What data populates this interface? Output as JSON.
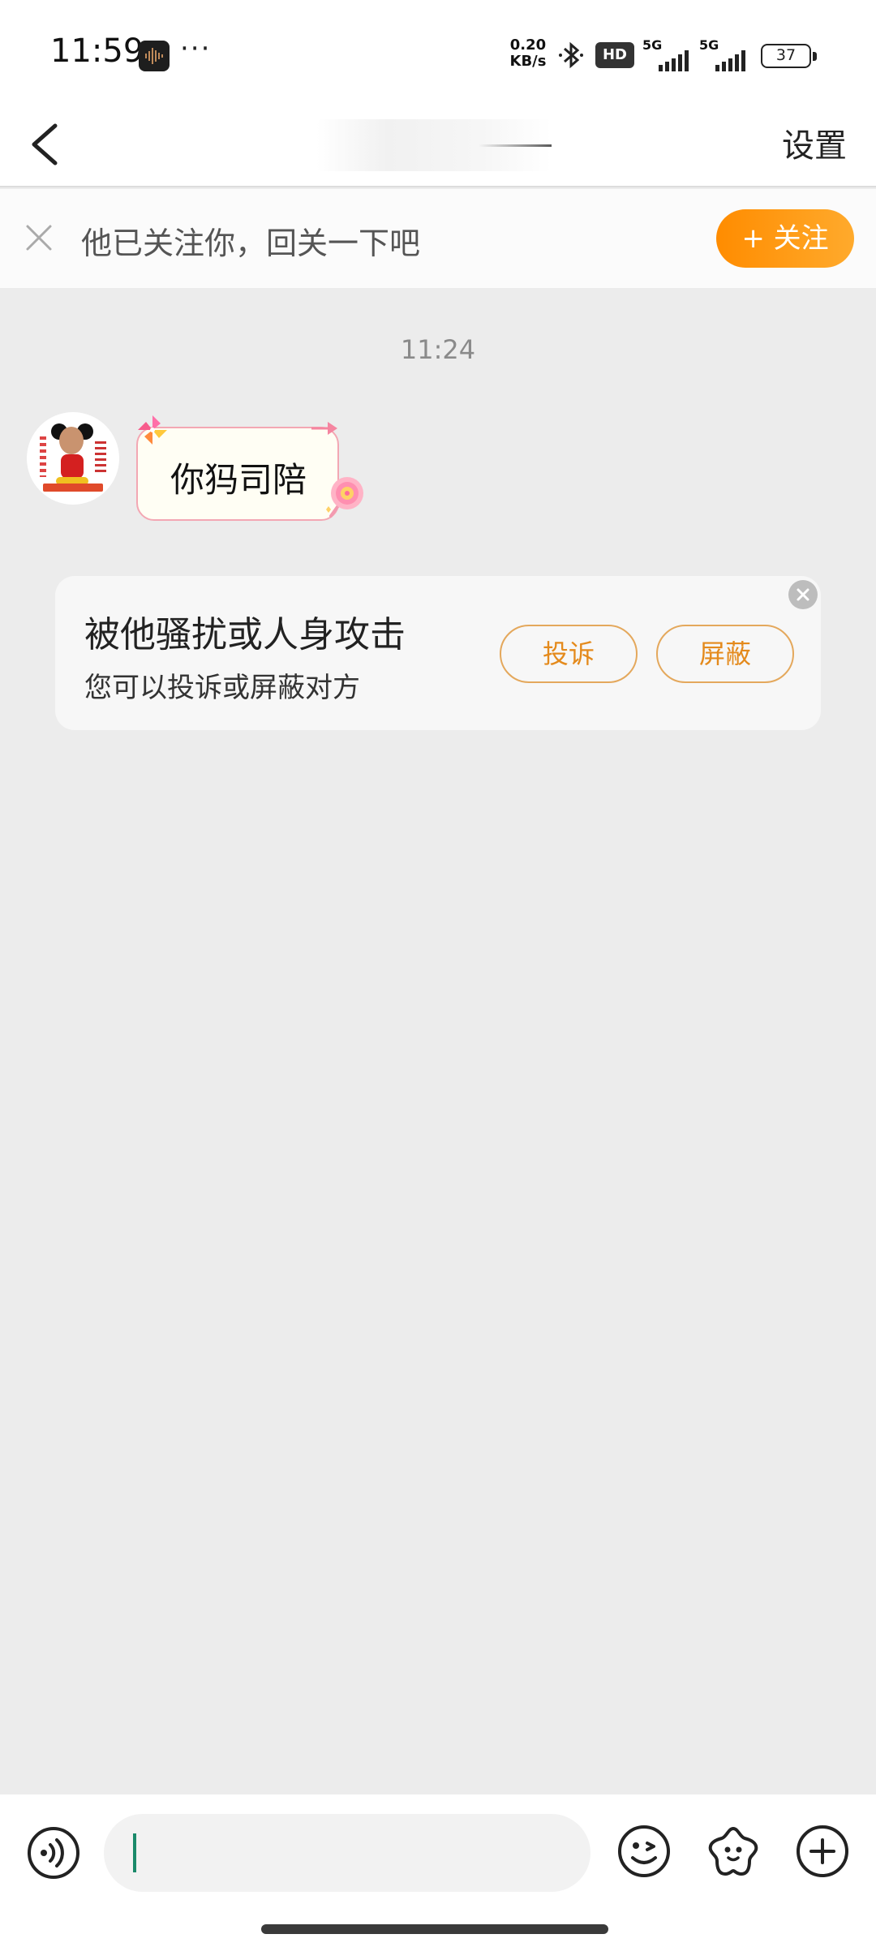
{
  "status_bar": {
    "time": "11:59",
    "more": "···",
    "net_speed_value": "0.20",
    "net_speed_unit": "KB/s",
    "hd_label": "HD",
    "sim1_label": "5G",
    "sim2_label": "5G",
    "battery": "37",
    "icons": [
      "audio-app-icon",
      "bluetooth-icon",
      "hd-voice-icon",
      "signal-icon",
      "battery-icon"
    ]
  },
  "header": {
    "back_icon": "chevron-left-icon",
    "title": "",
    "settings_label": "设置"
  },
  "follow_banner": {
    "text": "他已关注你，回关一下吧",
    "button_label": "+ 关注",
    "close_icon": "close-icon"
  },
  "chat": {
    "timestamp": "11:24",
    "messages": [
      {
        "sender": "other",
        "text": "你犸司陪"
      }
    ]
  },
  "report_card": {
    "title": "被他骚扰或人身攻击",
    "subtitle": "您可以投诉或屏蔽对方",
    "report_label": "投诉",
    "block_label": "屏蔽"
  },
  "input_bar": {
    "value": "",
    "icons": [
      "voice-icon",
      "emoji-icon",
      "sticker-icon",
      "plus-icon"
    ]
  },
  "colors": {
    "accent_orange": "#ff8c00",
    "card_button_text": "#e48a1c",
    "bubble_border": "#f3a7b3",
    "chat_background": "#ececec"
  }
}
